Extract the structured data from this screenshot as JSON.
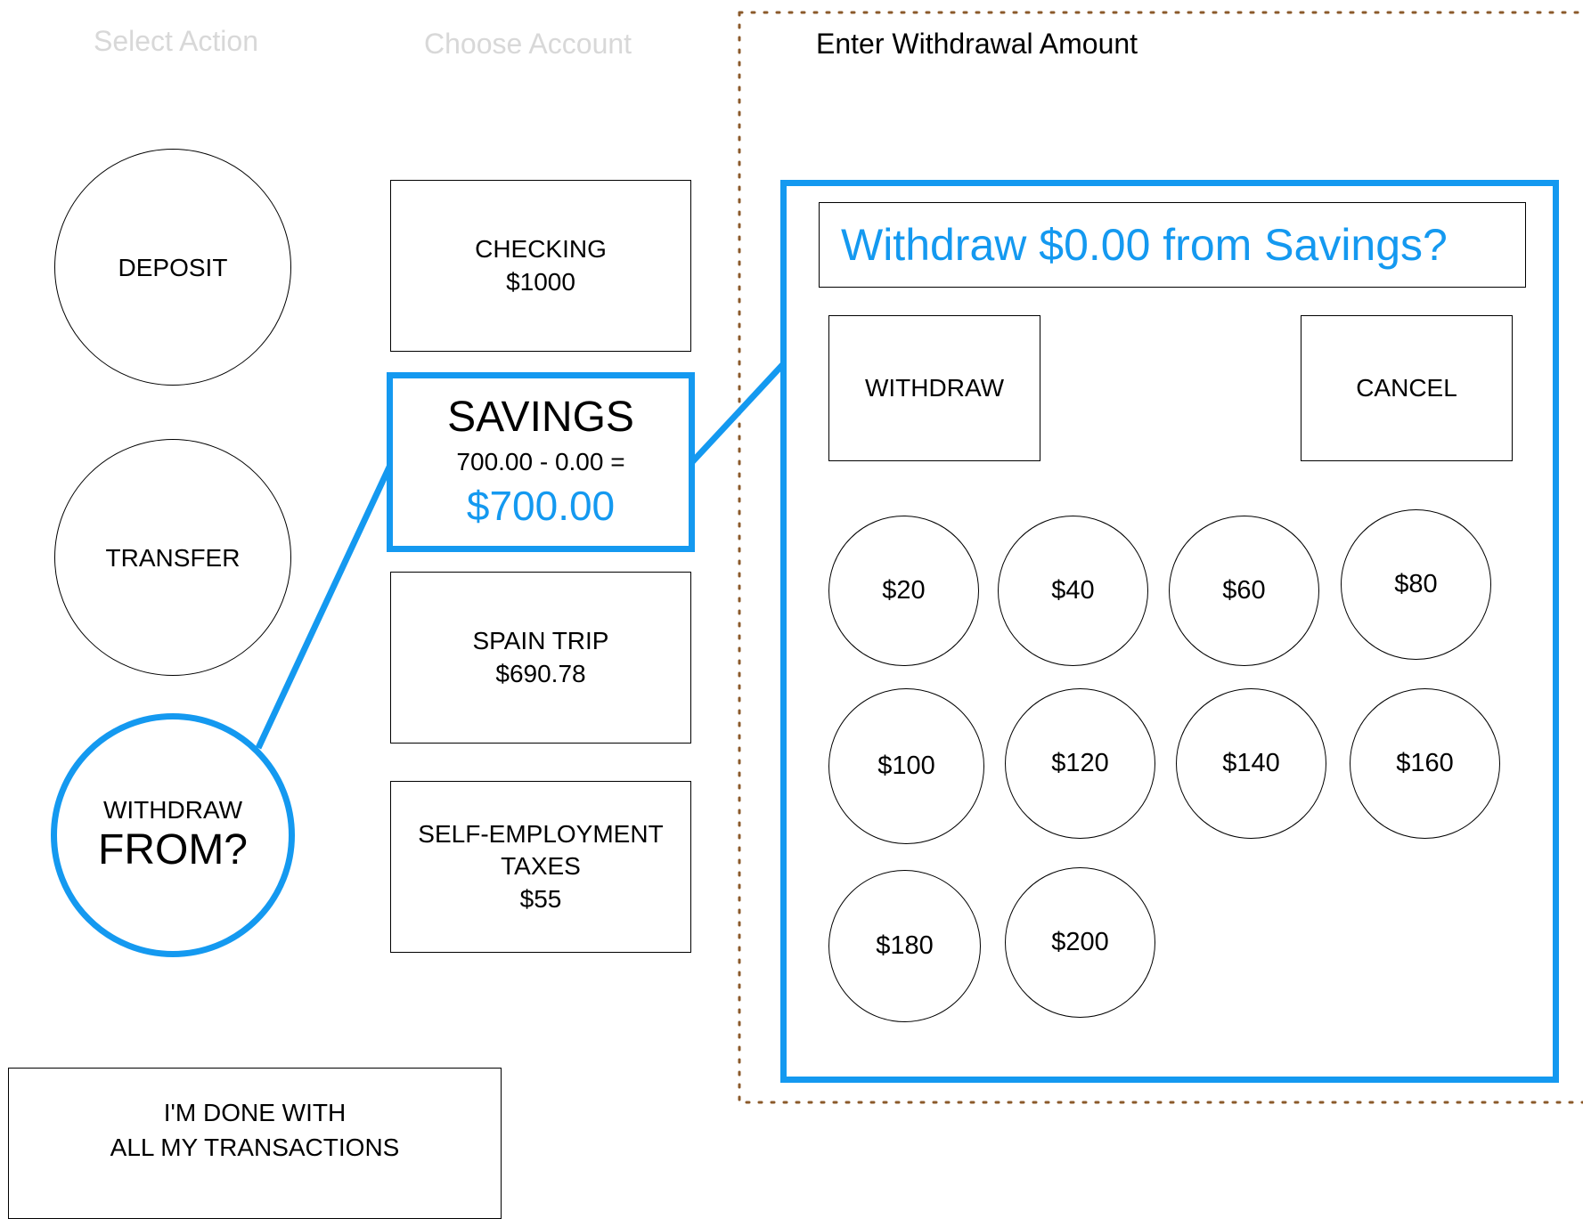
{
  "steps": {
    "select_action": "Select Action",
    "choose_account": "Choose Account",
    "enter_amount": "Enter Withdrawal Amount"
  },
  "actions": {
    "deposit": "DEPOSIT",
    "transfer": "TRANSFER",
    "withdraw_line1": "WITHDRAW",
    "withdraw_line2": "FROM?"
  },
  "accounts": {
    "checking": {
      "name": "CHECKING",
      "balance": "$1000"
    },
    "savings": {
      "name": "SAVINGS",
      "formula": "700.00 - 0.00 =",
      "result": "$700.00"
    },
    "spain_trip": {
      "name": "SPAIN TRIP",
      "balance": "$690.78"
    },
    "self_employment": {
      "name_line1": "SELF-EMPLOYMENT",
      "name_line2": "TAXES",
      "balance": "$55"
    }
  },
  "done_button": {
    "line1": "I'M DONE WITH",
    "line2": "ALL MY TRANSACTIONS"
  },
  "withdraw_panel": {
    "prompt": "Withdraw $0.00 from Savings?",
    "withdraw_label": "WITHDRAW",
    "cancel_label": "CANCEL",
    "amounts": [
      "$20",
      "$40",
      "$60",
      "$80",
      "$100",
      "$120",
      "$140",
      "$160",
      "$180",
      "$200"
    ]
  },
  "colors": {
    "accent": "#1499f0",
    "step_inactive": "#d8d8d8",
    "dotted_border": "#8b5a2b"
  }
}
